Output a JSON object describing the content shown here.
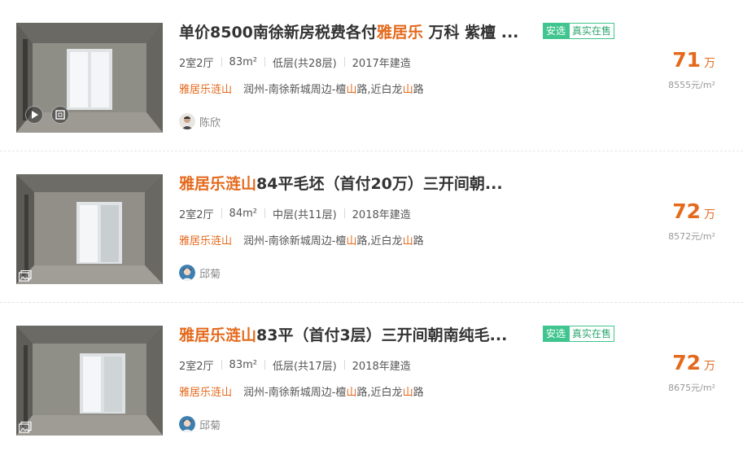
{
  "listings": [
    {
      "title_parts": [
        {
          "text": "单价8500南徐新房税费各付",
          "hl": false
        },
        {
          "text": "雅居乐",
          "hl": true
        },
        {
          "text": " 万科 紫檀 ...",
          "hl": false
        }
      ],
      "tags": [
        "安选",
        "真实在售"
      ],
      "rooms": "2室2厅",
      "area": "83m²",
      "floor": "低层(共28层)",
      "year": "2017年建造",
      "community": "雅居乐涟山",
      "address_parts": [
        {
          "text": "润州-南徐新城周边-檀",
          "hl": false
        },
        {
          "text": "山",
          "hl": true
        },
        {
          "text": "路,近白龙",
          "hl": false
        },
        {
          "text": "山",
          "hl": true
        },
        {
          "text": "路",
          "hl": false
        }
      ],
      "agent": "陈欣",
      "price": "71",
      "price_unit": "万",
      "unit_price": "8555元/m²",
      "media_icons": [
        "play-icon",
        "vr-icon"
      ]
    },
    {
      "title_parts": [
        {
          "text": "雅居乐涟山",
          "hl": true
        },
        {
          "text": "84平毛坯（首付20万）三开间朝...",
          "hl": false
        }
      ],
      "tags": [],
      "rooms": "2室2厅",
      "area": "84m²",
      "floor": "中层(共11层)",
      "year": "2018年建造",
      "community": "雅居乐涟山",
      "address_parts": [
        {
          "text": "润州-南徐新城周边-檀",
          "hl": false
        },
        {
          "text": "山",
          "hl": true
        },
        {
          "text": "路,近白龙",
          "hl": false
        },
        {
          "text": "山",
          "hl": true
        },
        {
          "text": "路",
          "hl": false
        }
      ],
      "agent": "邱菊",
      "price": "72",
      "price_unit": "万",
      "unit_price": "8572元/m²",
      "media_icons": [
        "gallery-icon"
      ]
    },
    {
      "title_parts": [
        {
          "text": "雅居乐涟山",
          "hl": true
        },
        {
          "text": "83平（首付3层）三开间朝南纯毛...",
          "hl": false
        }
      ],
      "tags": [
        "安选",
        "真实在售"
      ],
      "rooms": "2室2厅",
      "area": "83m²",
      "floor": "低层(共17层)",
      "year": "2018年建造",
      "community": "雅居乐涟山",
      "address_parts": [
        {
          "text": "润州-南徐新城周边-檀",
          "hl": false
        },
        {
          "text": "山",
          "hl": true
        },
        {
          "text": "路,近白龙",
          "hl": false
        },
        {
          "text": "山",
          "hl": true
        },
        {
          "text": "路",
          "hl": false
        }
      ],
      "agent": "邱菊",
      "price": "72",
      "price_unit": "万",
      "unit_price": "8675元/m²",
      "media_icons": [
        "gallery-icon"
      ]
    }
  ],
  "colors": {
    "accent": "#e4691c",
    "tag_green": "#40c58e",
    "text": "#333333",
    "muted": "#999999"
  }
}
